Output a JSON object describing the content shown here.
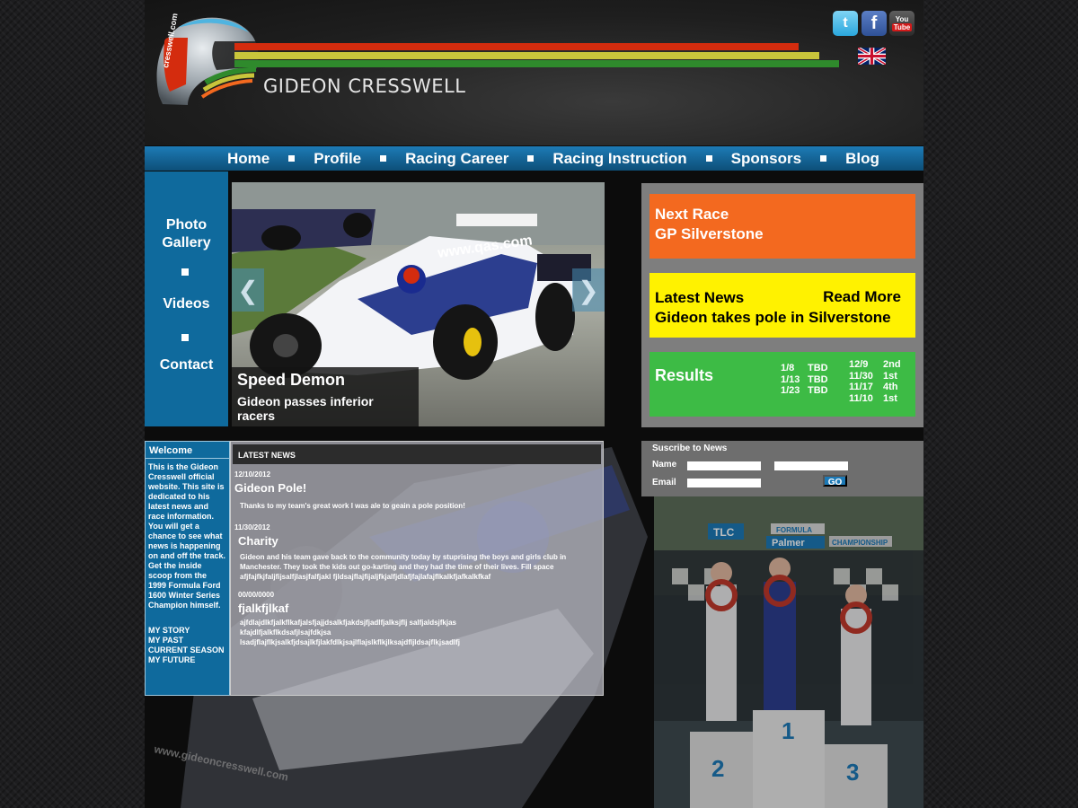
{
  "header": {
    "site_name": "GIDEON CRESSWELL",
    "helmet_text": "cresswell.com",
    "social": {
      "twitter": "t",
      "facebook": "f",
      "youtube_top": "You",
      "youtube_bottom": "Tube"
    }
  },
  "nav": {
    "items": [
      "Home",
      "Profile",
      "Racing Career",
      "Racing Instruction",
      "Sponsors",
      "Blog"
    ]
  },
  "sidenav": {
    "items": [
      "Photo Gallery",
      "Videos",
      "Contact"
    ]
  },
  "slider": {
    "title": "Speed Demon",
    "subtitle": "Gideon passes inferior racers",
    "prev_arrow": "❮",
    "next_arrow": "❯",
    "car_text": "www.qas.com"
  },
  "info": {
    "next_race_label": "Next Race",
    "next_race_value": "GP Silverstone",
    "latest_news_label": "Latest News",
    "read_more": "Read More",
    "latest_news_headline": "Gideon takes pole in Silverstone",
    "results_label": "Results",
    "upcoming": [
      {
        "date": "1/8",
        "result": "TBD"
      },
      {
        "date": "1/13",
        "result": "TBD"
      },
      {
        "date": "1/23",
        "result": "TBD"
      }
    ],
    "past": [
      {
        "date": "12/9",
        "result": "2nd"
      },
      {
        "date": "11/30",
        "result": "1st"
      },
      {
        "date": "11/17",
        "result": "4th"
      },
      {
        "date": "11/10",
        "result": "1st"
      }
    ]
  },
  "welcome": {
    "heading": "Welcome",
    "text": "This is the Gideon Cresswell official website. This site is dedicated to his latest news and race information. You will get a chance to see what news is happening on and off the track. Get the inside scoop from the 1999 Formula Ford 1600 Winter Series Champion himself.",
    "links": [
      "MY STORY",
      "MY PAST",
      "CURRENT SEASON",
      "MY FUTURE"
    ]
  },
  "news": {
    "heading": "LATEST NEWS",
    "posts": [
      {
        "date": "12/10/2012",
        "title": "Gideon Pole!",
        "body": "Thanks to my team's great work I was ale to geain a pole position!"
      },
      {
        "date": "11/30/2012",
        "title": "Charity",
        "body": "Gideon and his team gave back to the community today by stuprising the boys and girls club in Manchester. They took the kids out go-karting and they had the time of their lives. Fill space   afjfajfkjfaljfijsalfjlasjfalfjakl fjldsajflajfijaljfkjalfjdlafjfajlafajflkalkfjafkalkfkaf"
      },
      {
        "date": "00/00/0000",
        "title": "fjalkfjlkaf",
        "body": "ajfdlajdlkfjalkflkafjalsfjajjdsalkfjakdsjfjadlfjalksjflj salfjaldsjfkjas kfajdlfjalkflkdsafjlsajfdkjsa lsadjflajflkjsalkfjdsajlkfjlakfdlkjsajlflajslkflkjlksajdfljldsajflkjsadlfj"
      }
    ]
  },
  "subscribe": {
    "heading": "Suscribe to News",
    "name_label": "Name",
    "email_label": "Email",
    "go_label": "GO"
  },
  "podium": {
    "banner1": "TLC",
    "banner2": "FORMULA",
    "banner3": "Palmer",
    "banner4": "CHAMPIONSHIP",
    "steps": [
      "2",
      "1",
      "3"
    ]
  },
  "lower_bg_text": "www.gideoncresswell.com",
  "colors": {
    "nav_blue": "#1d7bb6",
    "side_blue": "#0f6a9d",
    "orange": "#f3691f",
    "yellow": "#fff200",
    "green": "#3dbb45",
    "stripe_red": "#d42c0e",
    "stripe_yellow": "#c9c53b",
    "stripe_green": "#2f8a2c"
  }
}
